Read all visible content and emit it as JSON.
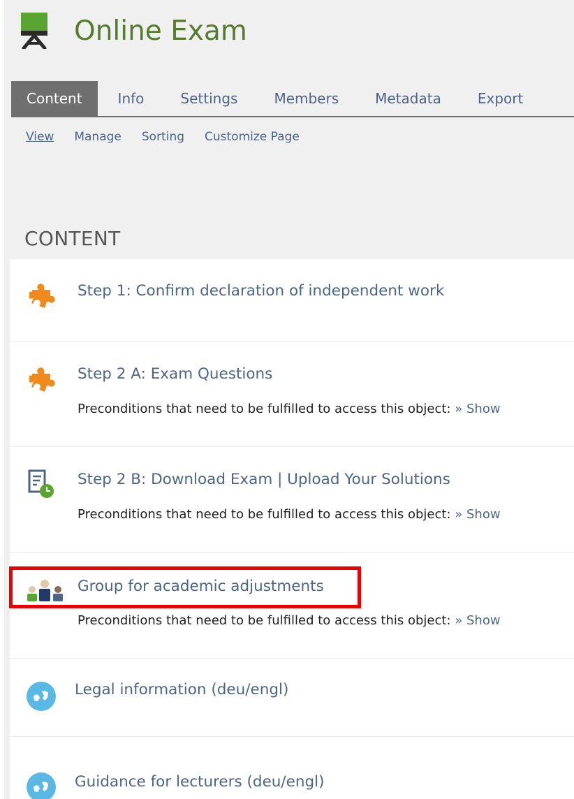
{
  "header": {
    "title": "Online Exam",
    "icon": "chalkboard-easel-icon"
  },
  "tabs": [
    {
      "label": "Content",
      "active": true
    },
    {
      "label": "Info"
    },
    {
      "label": "Settings"
    },
    {
      "label": "Members"
    },
    {
      "label": "Metadata"
    },
    {
      "label": "Export"
    }
  ],
  "subtabs": [
    {
      "label": "View",
      "active": true
    },
    {
      "label": "Manage"
    },
    {
      "label": "Sorting"
    },
    {
      "label": "Customize Page"
    }
  ],
  "content": {
    "heading": "CONTENT",
    "items": [
      {
        "title": "Step 1: Confirm declaration of independent work",
        "icon": "puzzle-icon"
      },
      {
        "title": "Step 2 A: Exam Questions",
        "icon": "puzzle-icon",
        "precondition": "Preconditions that need to be fulfilled to access this object:",
        "show": "» Show"
      },
      {
        "title": "Step 2 B: Download Exam | Upload Your Solutions",
        "icon": "exercise-clock-icon",
        "precondition": "Preconditions that need to be fulfilled to access this object:",
        "show": "» Show"
      },
      {
        "title": "Group for academic adjustments",
        "icon": "group-people-icon",
        "precondition": "Preconditions that need to be fulfilled to access this object:",
        "show": "» Show",
        "highlighted": true
      },
      {
        "title": "Legal information (deu/engl)",
        "icon": "globe-icon"
      },
      {
        "title": "Guidance for lecturers (deu/engl)",
        "icon": "globe-icon"
      }
    ]
  },
  "colors": {
    "title_green": "#557b2e",
    "link_blue": "#4c6586",
    "tab_active_bg": "#6f6f6f",
    "highlight_red": "#ee0000"
  }
}
